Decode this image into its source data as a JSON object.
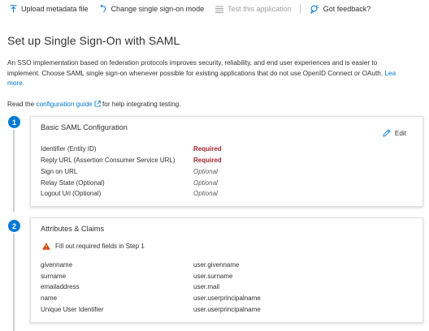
{
  "toolbar": {
    "upload": "Upload metadata file",
    "change": "Change single sign-on mode",
    "test": "Test this application",
    "feedback": "Got feedback?"
  },
  "page": {
    "title": "Set up Single Sign-On with SAML",
    "desc_line1": "An SSO implementation based on federation protocols improves security, reliability, and end user experiences and is easier to",
    "desc_line2_text": "implement. Choose SAML single sign-on whenever possible for existing applications that do not use OpenID Connect or OAuth. ",
    "desc_learn": "Lea",
    "desc_more": "more.",
    "read_prefix": "Read the ",
    "read_link": "configuration guide",
    "read_suffix": " for help integrating testing."
  },
  "steps": [
    {
      "number": "1",
      "title": "Basic SAML Configuration",
      "edit_label": "Edit",
      "rows": [
        {
          "label": "Identifier (Entity ID)",
          "value": "Required",
          "kind": "required"
        },
        {
          "label": "Reply URL (Assertion Consumer Service URL)",
          "value": "Required",
          "kind": "required"
        },
        {
          "label": "Sign on URL",
          "value": "Optional",
          "kind": "optional"
        },
        {
          "label": "Relay State (Optional)",
          "value": "Optional",
          "kind": "optional"
        },
        {
          "label": "Logout Url (Optional)",
          "value": "Optional",
          "kind": "optional"
        }
      ]
    },
    {
      "number": "2",
      "title": "Attributes & Claims",
      "warning": "Fill out required fields in Step 1",
      "rows": [
        {
          "label": "givenname",
          "value": "user.givenname"
        },
        {
          "label": "surname",
          "value": "user.surname"
        },
        {
          "label": "emailaddress",
          "value": "user.mail"
        },
        {
          "label": "name",
          "value": "user.userprincipalname"
        },
        {
          "label": "Unique User Identifier",
          "value": "user.userprincipalname"
        }
      ]
    }
  ],
  "colors": {
    "accent": "#0078d4",
    "required": "#a4262c",
    "warning": "#d83b01"
  }
}
